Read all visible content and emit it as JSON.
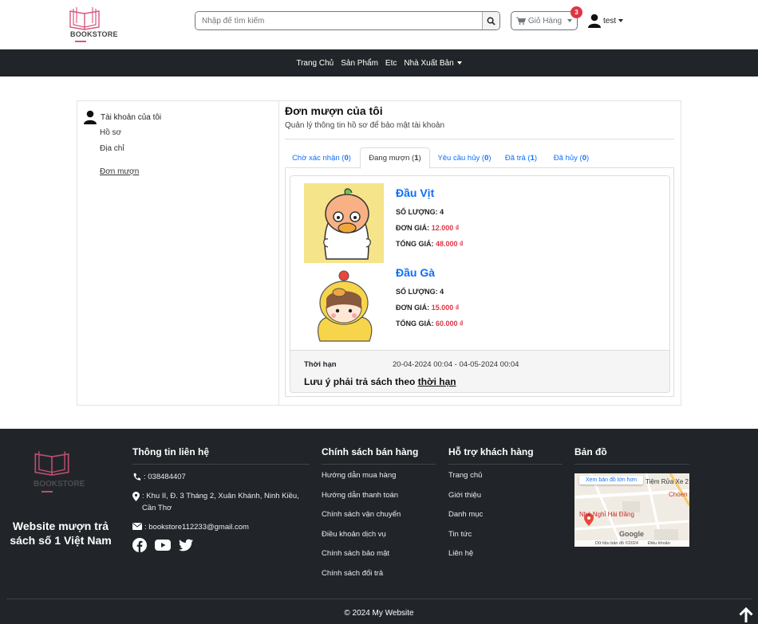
{
  "header": {
    "logo_text": "BOOKSTORE",
    "search_placeholder": "Nhập để tìm kiếm",
    "cart_label": "Giỏ Hàng",
    "cart_count": "3",
    "user_name": "test"
  },
  "nav": {
    "items": [
      "Trang Chủ",
      "Sản Phẩm",
      "Etc",
      "Nhà Xuất Bản"
    ]
  },
  "sidebar": {
    "account_label": "Tài khoản của tôi",
    "profile": "Hồ sơ",
    "address": "Địa chỉ",
    "orders": "Đơn mượn"
  },
  "main": {
    "title": "Đơn mượn của tôi",
    "subtitle": "Quản lý thông tin hồ sơ để bảo mật tài khoản",
    "tabs": [
      {
        "label": "Chờ xác nhận",
        "count": "0"
      },
      {
        "label": "Đang mượn",
        "count": "1"
      },
      {
        "label": "Yêu cầu hủy",
        "count": "0"
      },
      {
        "label": "Đã trả",
        "count": "1"
      },
      {
        "label": "Đã hủy",
        "count": "0"
      }
    ],
    "products": [
      {
        "name": "Đầu Vịt",
        "qty_label": "SỐ LƯỢNG:",
        "qty": "4",
        "price_label": "ĐƠN GIÁ:",
        "price": "12.000 ₫",
        "total_label": "TỔNG GIÁ:",
        "total": "48.000 ₫"
      },
      {
        "name": "Đầu Gà",
        "qty_label": "SỐ LƯỢNG:",
        "qty": "4",
        "price_label": "ĐƠN GIÁ:",
        "price": "15.000 ₫",
        "total_label": "TỔNG GIÁ:",
        "total": "60.000 ₫"
      }
    ],
    "deadline_label": "Thời hạn",
    "deadline_value": "20-04-2024 00:04 - 04-05-2024 00:04",
    "note_prefix": "Lưu ý phải trả sách theo ",
    "note_link": "thời hạn"
  },
  "footer": {
    "tagline": "Website mượn trả sách số 1 Việt Nam",
    "contact_title": "Thông tin liên hệ",
    "phone": ": 038484407",
    "address": ": Khu II, Đ. 3 Tháng 2, Xuân Khánh, Ninh Kiều, Cần Thơ",
    "email": ": bookstore112233@gmail.com",
    "policy_title": "Chính sách bán hàng",
    "policy_items": [
      "Hướng dẫn mua hàng",
      "Hướng dẫn thanh toán",
      "Chính sách vận chuyển",
      "Điều khoản dịch vụ",
      "Chính sách bảo mật",
      "Chính sách đổi trả"
    ],
    "support_title": "Hỗ trợ khách hàng",
    "support_items": [
      "Trang chủ",
      "Giới thiệu",
      "Danh mục",
      "Tin tức",
      "Liên hệ"
    ],
    "map_title": "Bản đồ",
    "map_link": "Xem bản đồ lớn hơn",
    "map_labels": [
      "Tiệm Rửa Xe 2",
      "Chóen",
      "Nhà Nghỉ Hải Đăng",
      "Google",
      "Dữ liệu bản đồ ©2024",
      "Điều khoản"
    ],
    "copyright": "© 2024 My Website"
  },
  "colors": {
    "accent": "#0d6efd",
    "danger": "#dc3545",
    "dark": "#212529",
    "brand_pink": "#d9577d"
  }
}
